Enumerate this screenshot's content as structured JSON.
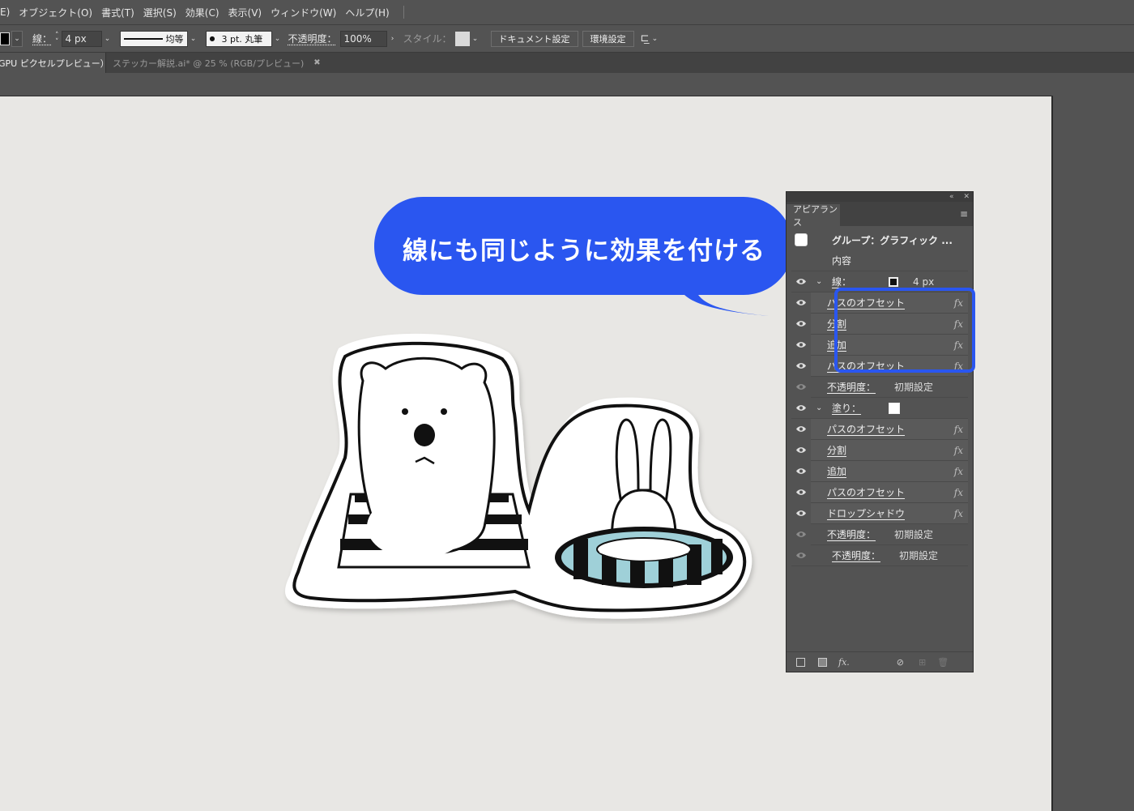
{
  "menubar": {
    "items": [
      "E)",
      "オブジェクト(O)",
      "書式(T)",
      "選択(S)",
      "効果(C)",
      "表示(V)",
      "ウィンドウ(W)",
      "ヘルプ(H)"
    ]
  },
  "controlbar": {
    "stroke_label": "線：",
    "stroke_weight": "4 px",
    "profile_label": "均等",
    "brush_label": "3 pt. 丸筆",
    "opacity_label": "不透明度：",
    "opacity_value": "100%",
    "style_label": "スタイル：",
    "doc_settings": "ドキュメント設定",
    "preferences": "環境設定"
  },
  "tabs": [
    {
      "label": "GPU ピクセルプレビュー）",
      "active": true
    },
    {
      "label": "ステッカー解説.ai* @ 25 % (RGB/プレビュー)",
      "active": false
    }
  ],
  "bubble": {
    "text": "線にも同じように効果を付ける",
    "color": "#2a56f0"
  },
  "appearance_panel": {
    "tab_label": "アピアランス",
    "group_label": "グループ：グラフィック ...",
    "contents_label": "内容",
    "stroke": {
      "label": "線：",
      "weight": "4 px",
      "effects": [
        "パスのオフセット",
        "分割",
        "追加",
        "パスのオフセット"
      ],
      "opacity_label": "不透明度：",
      "opacity_value": "初期設定"
    },
    "fill": {
      "label": "塗り：",
      "effects": [
        "パスのオフセット",
        "分割",
        "追加",
        "パスのオフセット",
        "ドロップシャドウ"
      ],
      "opacity_label": "不透明度：",
      "opacity_value": "初期設定"
    },
    "opacity_label": "不透明度：",
    "opacity_value": "初期設定",
    "fx_glyph": "fx"
  },
  "colors": {
    "highlight": "#2a56f0",
    "artboard": "#e8e7e4",
    "sticker_accent": "#9fd0d8"
  }
}
